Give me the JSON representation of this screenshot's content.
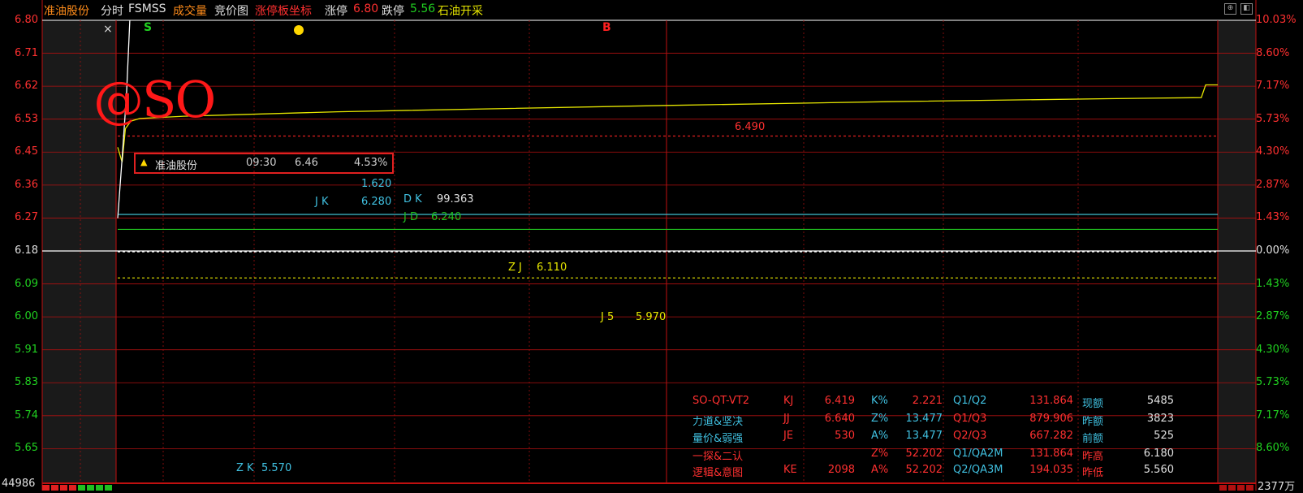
{
  "header": {
    "stock_name": "准油股份",
    "tab_fenshi": "分时",
    "tab_fsmss": "FSMSS",
    "tab_volume": "成交量",
    "tab_auction": "竞价图",
    "tab_limit_axis": "涨停板坐标",
    "limit_up_label": "涨停",
    "limit_up_value": "6.80",
    "limit_down_label": "跌停",
    "limit_down_value": "5.56",
    "sector": "石油开采"
  },
  "window_buttons": {
    "restore": "⊕",
    "dock": "◧"
  },
  "close_glyph": "×",
  "markers": {
    "s": "S",
    "b": "B"
  },
  "watermark": "@SO",
  "popup": {
    "name": "准油股份",
    "time": "09:30",
    "price": "6.46",
    "pct": "4.53%"
  },
  "levels": {
    "l6490": "6.490",
    "v1620": "1.620",
    "jk_label": "J K",
    "jk_value": "6.280",
    "dk_label": "D K",
    "dk_value": "99.363",
    "jd_label": "J D",
    "jd_value": "6.240",
    "zj_label": "Z J",
    "zj_value": "6.110",
    "j5_label": "J 5",
    "j5_value": "5.970",
    "zk_label": "Z K",
    "zk_value": "5.570"
  },
  "footer": {
    "left_volume": "44986",
    "right_unit": "2377万"
  },
  "info_table": {
    "rows": [
      [
        "SO-QT-VT2",
        "KJ",
        "6.419",
        "K%",
        "2.221",
        "Q1/Q2",
        "131.864",
        "现额",
        "5485"
      ],
      [
        "力道&坚决",
        "JJ",
        "6.640",
        "Z%",
        "13.477",
        "Q1/Q3",
        "879.906",
        "昨额",
        "3823"
      ],
      [
        "量价&弱强",
        "JE",
        "530",
        "A%",
        "13.477",
        "Q2/Q3",
        "667.282",
        "前额",
        "525"
      ],
      [
        "一探&二认",
        "",
        "",
        "Z%",
        "52.202",
        "Q1/QA2M",
        "131.864",
        "昨高",
        "6.180"
      ],
      [
        "逻辑&意图",
        "KE",
        "2098",
        "A%",
        "52.202",
        "Q2/QA3M",
        "194.035",
        "昨低",
        "5.560"
      ]
    ]
  },
  "chart_data": {
    "type": "line",
    "title": "",
    "xlabel": "",
    "ylabel": "",
    "prev_close": 6.18,
    "ylim": [
      5.56,
      6.8
    ],
    "y_ticks_left": [
      "6.80",
      "6.71",
      "6.62",
      "6.53",
      "6.45",
      "6.36",
      "6.27",
      "6.18",
      "6.09",
      "6.00",
      "5.91",
      "5.83",
      "5.74",
      "5.65"
    ],
    "y_ticks_right": [
      "10.03%",
      "8.60%",
      "7.17%",
      "5.73%",
      "4.30%",
      "2.87%",
      "1.43%",
      "0.00%",
      "1.43%",
      "2.87%",
      "4.30%",
      "5.73%",
      "7.17%",
      "8.60%"
    ],
    "series": [
      {
        "name": "",
        "color": "#e6e600",
        "x_frac": [
          0.0,
          0.004,
          0.007,
          0.012,
          0.02,
          0.06,
          0.2,
          0.5,
          0.7,
          0.9,
          0.985,
          0.989,
          1.0
        ],
        "values": [
          6.46,
          6.42,
          6.51,
          6.53,
          6.537,
          6.543,
          6.555,
          6.572,
          6.582,
          6.59,
          6.593,
          6.627,
          6.627
        ]
      },
      {
        "name": "",
        "color": "#ffffff",
        "x_frac": [
          0.0,
          0.004,
          0.008,
          0.011
        ],
        "values": [
          6.27,
          6.43,
          6.6,
          6.8
        ]
      }
    ],
    "horizontal_levels": [
      {
        "value": 6.49,
        "color": "#e02020",
        "dash": true
      },
      {
        "value": 6.28,
        "color": "#40c0d0",
        "dash": false
      },
      {
        "value": 6.24,
        "color": "#20c020",
        "dash": false
      },
      {
        "value": 6.18,
        "color": "#ffffff",
        "dash": true
      },
      {
        "value": 6.11,
        "color": "#e6e600",
        "dash": true
      }
    ]
  }
}
